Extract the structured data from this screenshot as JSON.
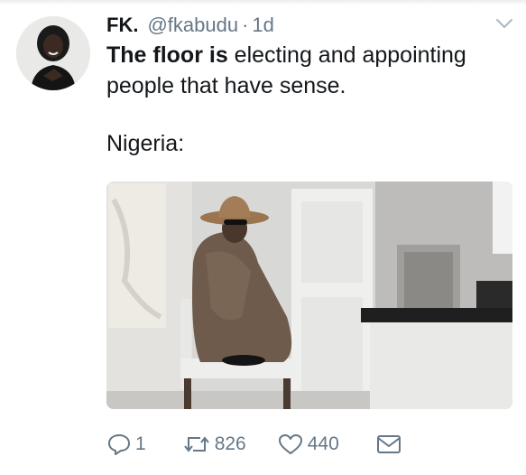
{
  "tweet": {
    "display_name": "FK.",
    "handle": "@fkabudu",
    "separator": "·",
    "time": "1d",
    "text_bold": "The floor is",
    "text_rest": " electing and appointing",
    "text_line2": "people that have sense.",
    "text_line3": "Nigeria:"
  },
  "actions": {
    "reply_count": "1",
    "retweet_count": "826",
    "like_count": "440"
  },
  "icons": {
    "caret": "chevron-down-icon",
    "reply": "reply-icon",
    "retweet": "retweet-icon",
    "like": "heart-icon",
    "dm": "envelope-icon"
  },
  "colors": {
    "text": "#14171a",
    "muted": "#657786",
    "background": "#ffffff"
  }
}
